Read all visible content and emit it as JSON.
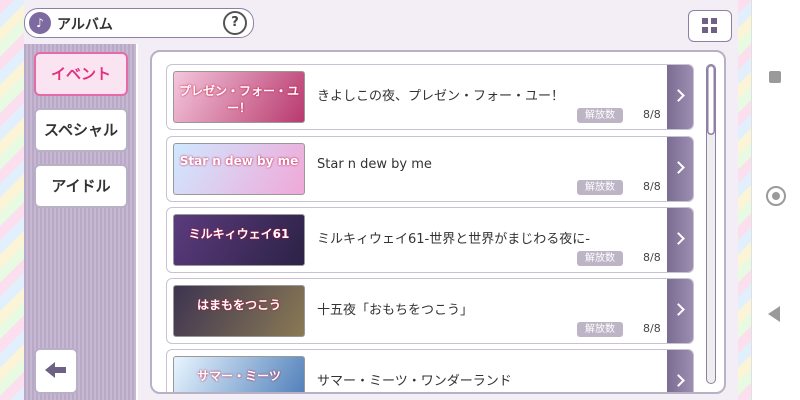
{
  "header": {
    "title": "アルバム",
    "help_label": "?"
  },
  "sidebar": {
    "items": [
      {
        "label": "イベント",
        "active": true
      },
      {
        "label": "スペシャル",
        "active": false
      },
      {
        "label": "アイドル",
        "active": false
      }
    ]
  },
  "release_label": "解放数",
  "rows": [
    {
      "title": "きよしこの夜、プレゼン・フォー・ユー！",
      "count": "8/8",
      "thumb_text": "プレゼン・フォー・ユー！",
      "thumb_colors": [
        "#f4c6dc",
        "#b83a6e"
      ]
    },
    {
      "title": "Star n dew by me",
      "count": "8/8",
      "thumb_text": "Star n dew by me",
      "thumb_colors": [
        "#cfe8ff",
        "#f0a8d8"
      ]
    },
    {
      "title": "ミルキィウェイ61-世界と世界がまじわる夜に-",
      "count": "8/8",
      "thumb_text": "ミルキィウェイ61",
      "thumb_colors": [
        "#5b3b7d",
        "#2c2246"
      ]
    },
    {
      "title": "十五夜「おもちをつこう」",
      "count": "8/8",
      "thumb_text": "はまもをつこう",
      "thumb_colors": [
        "#3d3450",
        "#8a7a55"
      ]
    },
    {
      "title": "サマー・ミーツ・ワンダーランド",
      "count": "",
      "thumb_text": "サマー・ミーツ",
      "thumb_colors": [
        "#e8f5ff",
        "#4a7bb7"
      ]
    }
  ],
  "colors": {
    "accent": "#e0307f",
    "panel_border": "#b8b0c4",
    "chevron": "#7b6d92"
  },
  "icons": {
    "header": "music-note-icon",
    "grid": "grid-icon",
    "back": "arrow-left-icon"
  }
}
